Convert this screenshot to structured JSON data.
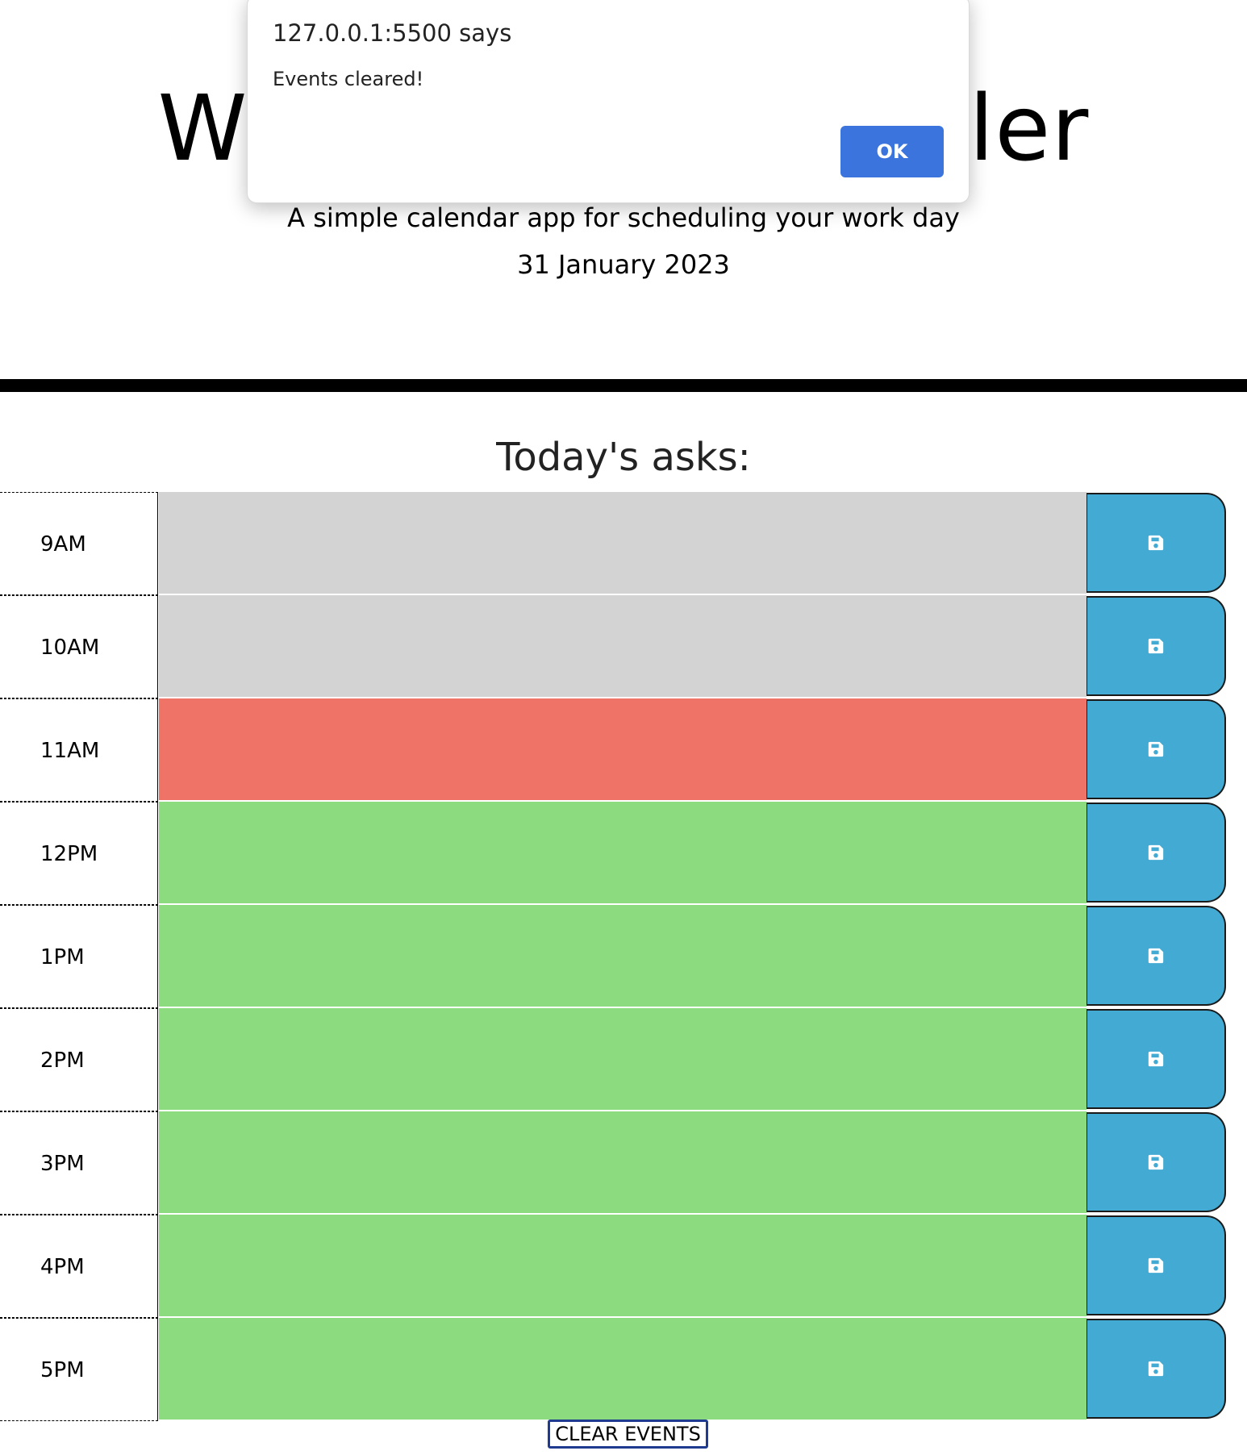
{
  "header": {
    "title": "Work Day Scheduler",
    "subtitle": "A simple calendar app for scheduling your work day",
    "current_day": "31 January 2023"
  },
  "tasks_heading": "Today's asks:",
  "timeblocks": [
    {
      "hour": "9AM",
      "status": "past",
      "text": ""
    },
    {
      "hour": "10AM",
      "status": "past",
      "text": ""
    },
    {
      "hour": "11AM",
      "status": "present",
      "text": ""
    },
    {
      "hour": "12PM",
      "status": "future",
      "text": ""
    },
    {
      "hour": "1PM",
      "status": "future",
      "text": ""
    },
    {
      "hour": "2PM",
      "status": "future",
      "text": ""
    },
    {
      "hour": "3PM",
      "status": "future",
      "text": ""
    },
    {
      "hour": "4PM",
      "status": "future",
      "text": ""
    },
    {
      "hour": "5PM",
      "status": "future",
      "text": ""
    }
  ],
  "save_icon": "floppy-disk-icon",
  "clear_button_label": "CLEAR EVENTS",
  "alert": {
    "origin": "127.0.0.1:5500 says",
    "message": "Events cleared!",
    "ok_label": "OK"
  },
  "colors": {
    "past": "#d3d3d3",
    "present": "#ef7366",
    "future": "#8cdb7f",
    "save_button": "#43aad4",
    "alert_ok": "#3a74dc"
  }
}
